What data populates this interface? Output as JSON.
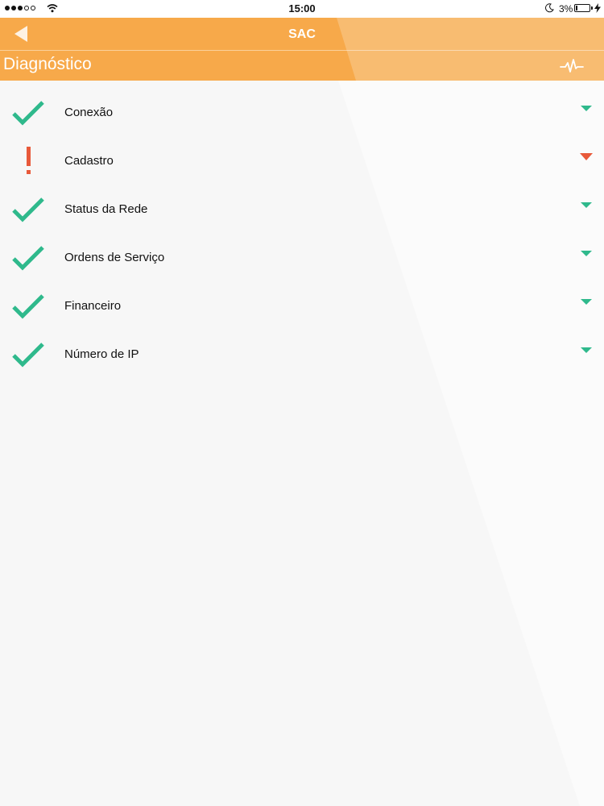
{
  "status_bar": {
    "time": "15:00",
    "battery_percent": "3%",
    "signal_bars_filled": 3,
    "signal_bars_total": 5
  },
  "header": {
    "nav_title": "SAC",
    "page_title": "Diagnóstico",
    "back_icon": "back-arrow-icon",
    "action_icon": "pulse-icon"
  },
  "colors": {
    "header": "#f7a94a",
    "ok": "#2fb98c",
    "error": "#e8593a",
    "background": "#f7f7f7"
  },
  "items": [
    {
      "label": "Conexão",
      "status": "ok"
    },
    {
      "label": "Cadastro",
      "status": "error"
    },
    {
      "label": "Status da Rede",
      "status": "ok"
    },
    {
      "label": "Ordens de Serviço",
      "status": "ok"
    },
    {
      "label": "Financeiro",
      "status": "ok"
    },
    {
      "label": "Número de IP",
      "status": "ok"
    }
  ]
}
